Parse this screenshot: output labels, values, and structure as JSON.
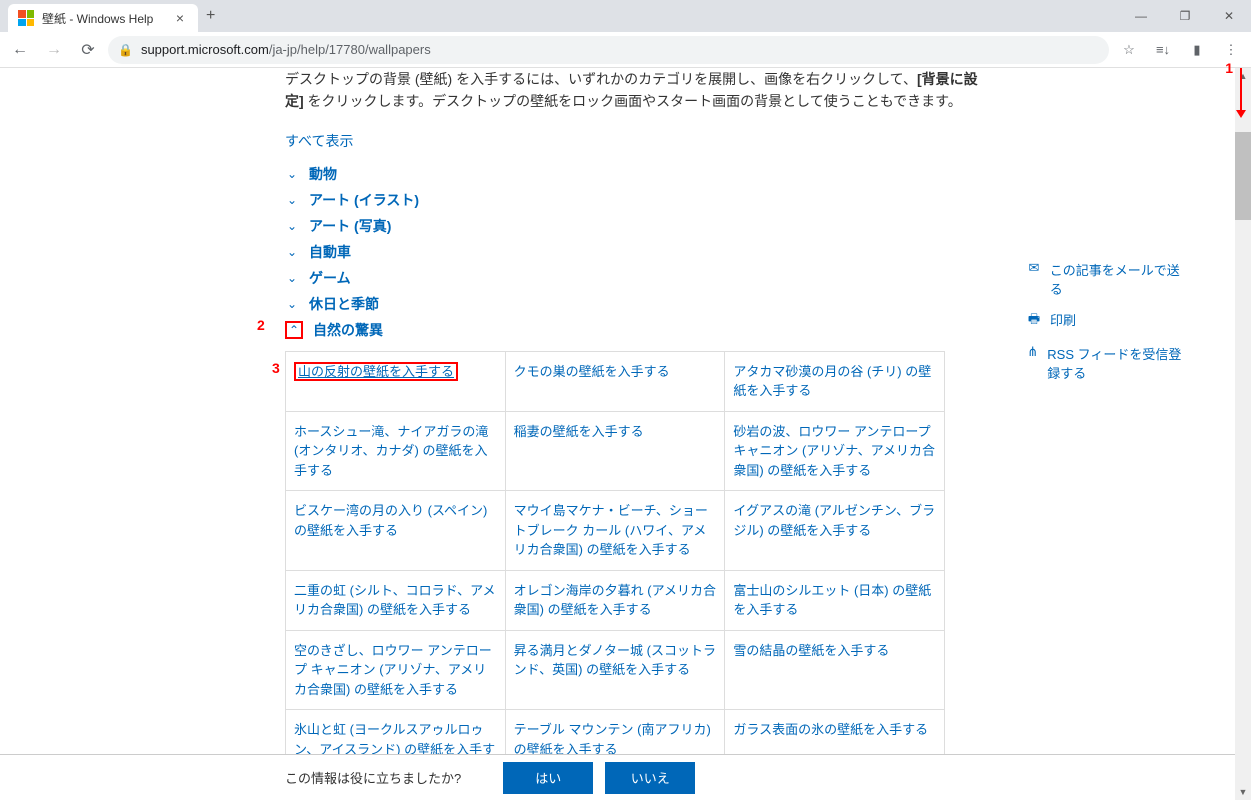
{
  "browser": {
    "tab_title": "壁紙 - Windows Help",
    "url_host": "support.microsoft.com",
    "url_path": "/ja-jp/help/17780/wallpapers"
  },
  "intro": {
    "part1": "デスクトップの背景 (壁紙) を入手するには、いずれかのカテゴリを展開し、画像を右クリックして、",
    "bold": "[背景に設定]",
    "part2": " をクリックします。デスクトップの壁紙をロック画面やスタート画面の背景として使うこともできます。"
  },
  "show_all": "すべて表示",
  "categories": [
    "動物",
    "アート (イラスト)",
    "アート (写真)",
    "自動車",
    "ゲーム",
    "休日と季節",
    "自然の驚異"
  ],
  "table": [
    [
      "山の反射の壁紙を入手する",
      "クモの巣の壁紙を入手する",
      "アタカマ砂漠の月の谷 (チリ) の壁紙を入手する"
    ],
    [
      "ホースシュー滝、ナイアガラの滝 (オンタリオ、カナダ) の壁紙を入手する",
      "稲妻の壁紙を入手する",
      "砂岩の波、ロウワー アンテロープ キャニオン (アリゾナ、アメリカ合衆国) の壁紙を入手する"
    ],
    [
      "ビスケー湾の月の入り (スペイン) の壁紙を入手する",
      "マウイ島マケナ・ビーチ、ショートブレーク カール (ハワイ、アメリカ合衆国) の壁紙を入手する",
      "イグアスの滝 (アルゼンチン、ブラジル) の壁紙を入手する"
    ],
    [
      "二重の虹 (シルト、コロラド、アメリカ合衆国) の壁紙を入手する",
      "オレゴン海岸の夕暮れ (アメリカ合衆国) の壁紙を入手する",
      "富士山のシルエット (日本) の壁紙を入手する"
    ],
    [
      "空のきざし、ロウワー アンテロープ キャニオン (アリゾナ、アメリカ合衆国) の壁紙を入手する",
      "昇る満月とダノター城 (スコットランド、英国) の壁紙を入手する",
      "雪の結晶の壁紙を入手する"
    ],
    [
      "氷山と虹 (ヨークルスアゥルロゥン、アイスランド) の壁紙を入手する",
      "テーブル マウンテン (南アフリカ) の壁紙を入手する",
      "ガラス表面の氷の壁紙を入手する"
    ]
  ],
  "right": {
    "email": "この記事をメールで送る",
    "print": "印刷",
    "rss": "RSS フィードを受信登録する"
  },
  "feedback": {
    "question": "この情報は役に立ちましたか?",
    "yes": "はい",
    "no": "いいえ"
  },
  "annotations": {
    "a1": "1",
    "a2": "2",
    "a3": "3"
  }
}
